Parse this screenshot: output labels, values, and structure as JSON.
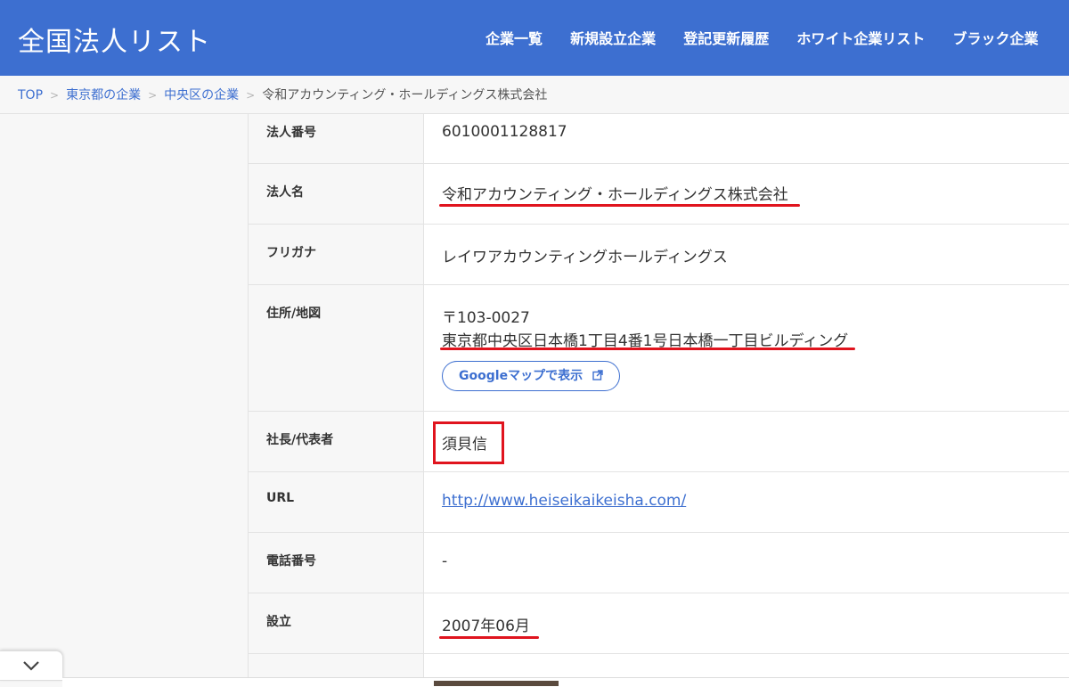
{
  "header": {
    "logo": "全国法人リスト",
    "nav": [
      "企業一覧",
      "新規設立企業",
      "登記更新履歴",
      "ホワイト企業リスト",
      "ブラック企業"
    ]
  },
  "breadcrumb": {
    "items": [
      "TOP",
      "東京都の企業",
      "中央区の企業"
    ],
    "current": "令和アカウンティング・ホールディングス株式会社"
  },
  "table": {
    "corp_number_label": "法人番号",
    "corp_number": "6010001128817",
    "name_label": "法人名",
    "name": "令和アカウンティング・ホールディングス株式会社",
    "furigana_label": "フリガナ",
    "furigana": "レイワアカウンティングホールディングス",
    "address_label": "住所/地図",
    "postal": "〒103-0027",
    "address": "東京都中央区日本橋1丁目4番1号日本橋一丁目ビルディング",
    "map_button": "Googleマップで表示",
    "ceo_label": "社長/代表者",
    "ceo": "須貝信",
    "url_label": "URL",
    "url": "http://www.heiseikaikeisha.com/",
    "phone_label": "電話番号",
    "phone": "-",
    "founded_label": "設立",
    "founded": "2007年06月"
  },
  "colors": {
    "brand": "#3d6fd0",
    "annotation": "#e0141e"
  },
  "icons": {
    "external_link": "external-link-icon",
    "chevron": "chevron-down-icon",
    "breadcrumb_sep": "chevron-right-icon"
  }
}
